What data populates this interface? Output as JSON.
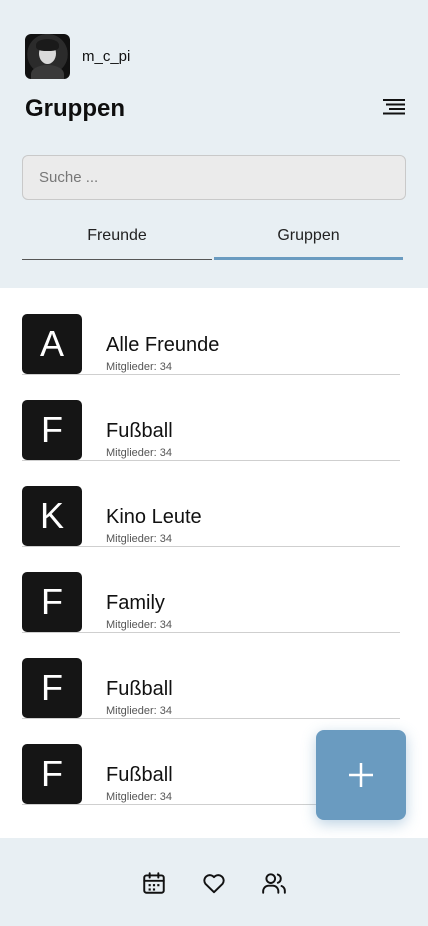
{
  "user": {
    "name": "m_c_pi"
  },
  "header": {
    "title": "Gruppen"
  },
  "search": {
    "placeholder": "Suche ..."
  },
  "tabs": [
    {
      "label": "Freunde",
      "active": false
    },
    {
      "label": "Gruppen",
      "active": true
    }
  ],
  "groups": [
    {
      "letter": "A",
      "name": "Alle Freunde",
      "members": "Mitglieder: 34"
    },
    {
      "letter": "F",
      "name": "Fußball",
      "members": "Mitglieder: 34"
    },
    {
      "letter": "K",
      "name": "Kino Leute",
      "members": "Mitglieder: 34"
    },
    {
      "letter": "F",
      "name": "Family",
      "members": "Mitglieder: 34"
    },
    {
      "letter": "F",
      "name": "Fußball",
      "members": "Mitglieder: 34"
    },
    {
      "letter": "F",
      "name": "Fußball",
      "members": "Mitglieder: 34"
    }
  ],
  "fab": {
    "icon": "plus-icon"
  },
  "bottom_nav": [
    {
      "icon": "calendar-icon"
    },
    {
      "icon": "heart-icon"
    },
    {
      "icon": "users-icon"
    }
  ],
  "colors": {
    "background": "#e8eff3",
    "accent": "#6a9bc0",
    "tile": "#151515"
  }
}
